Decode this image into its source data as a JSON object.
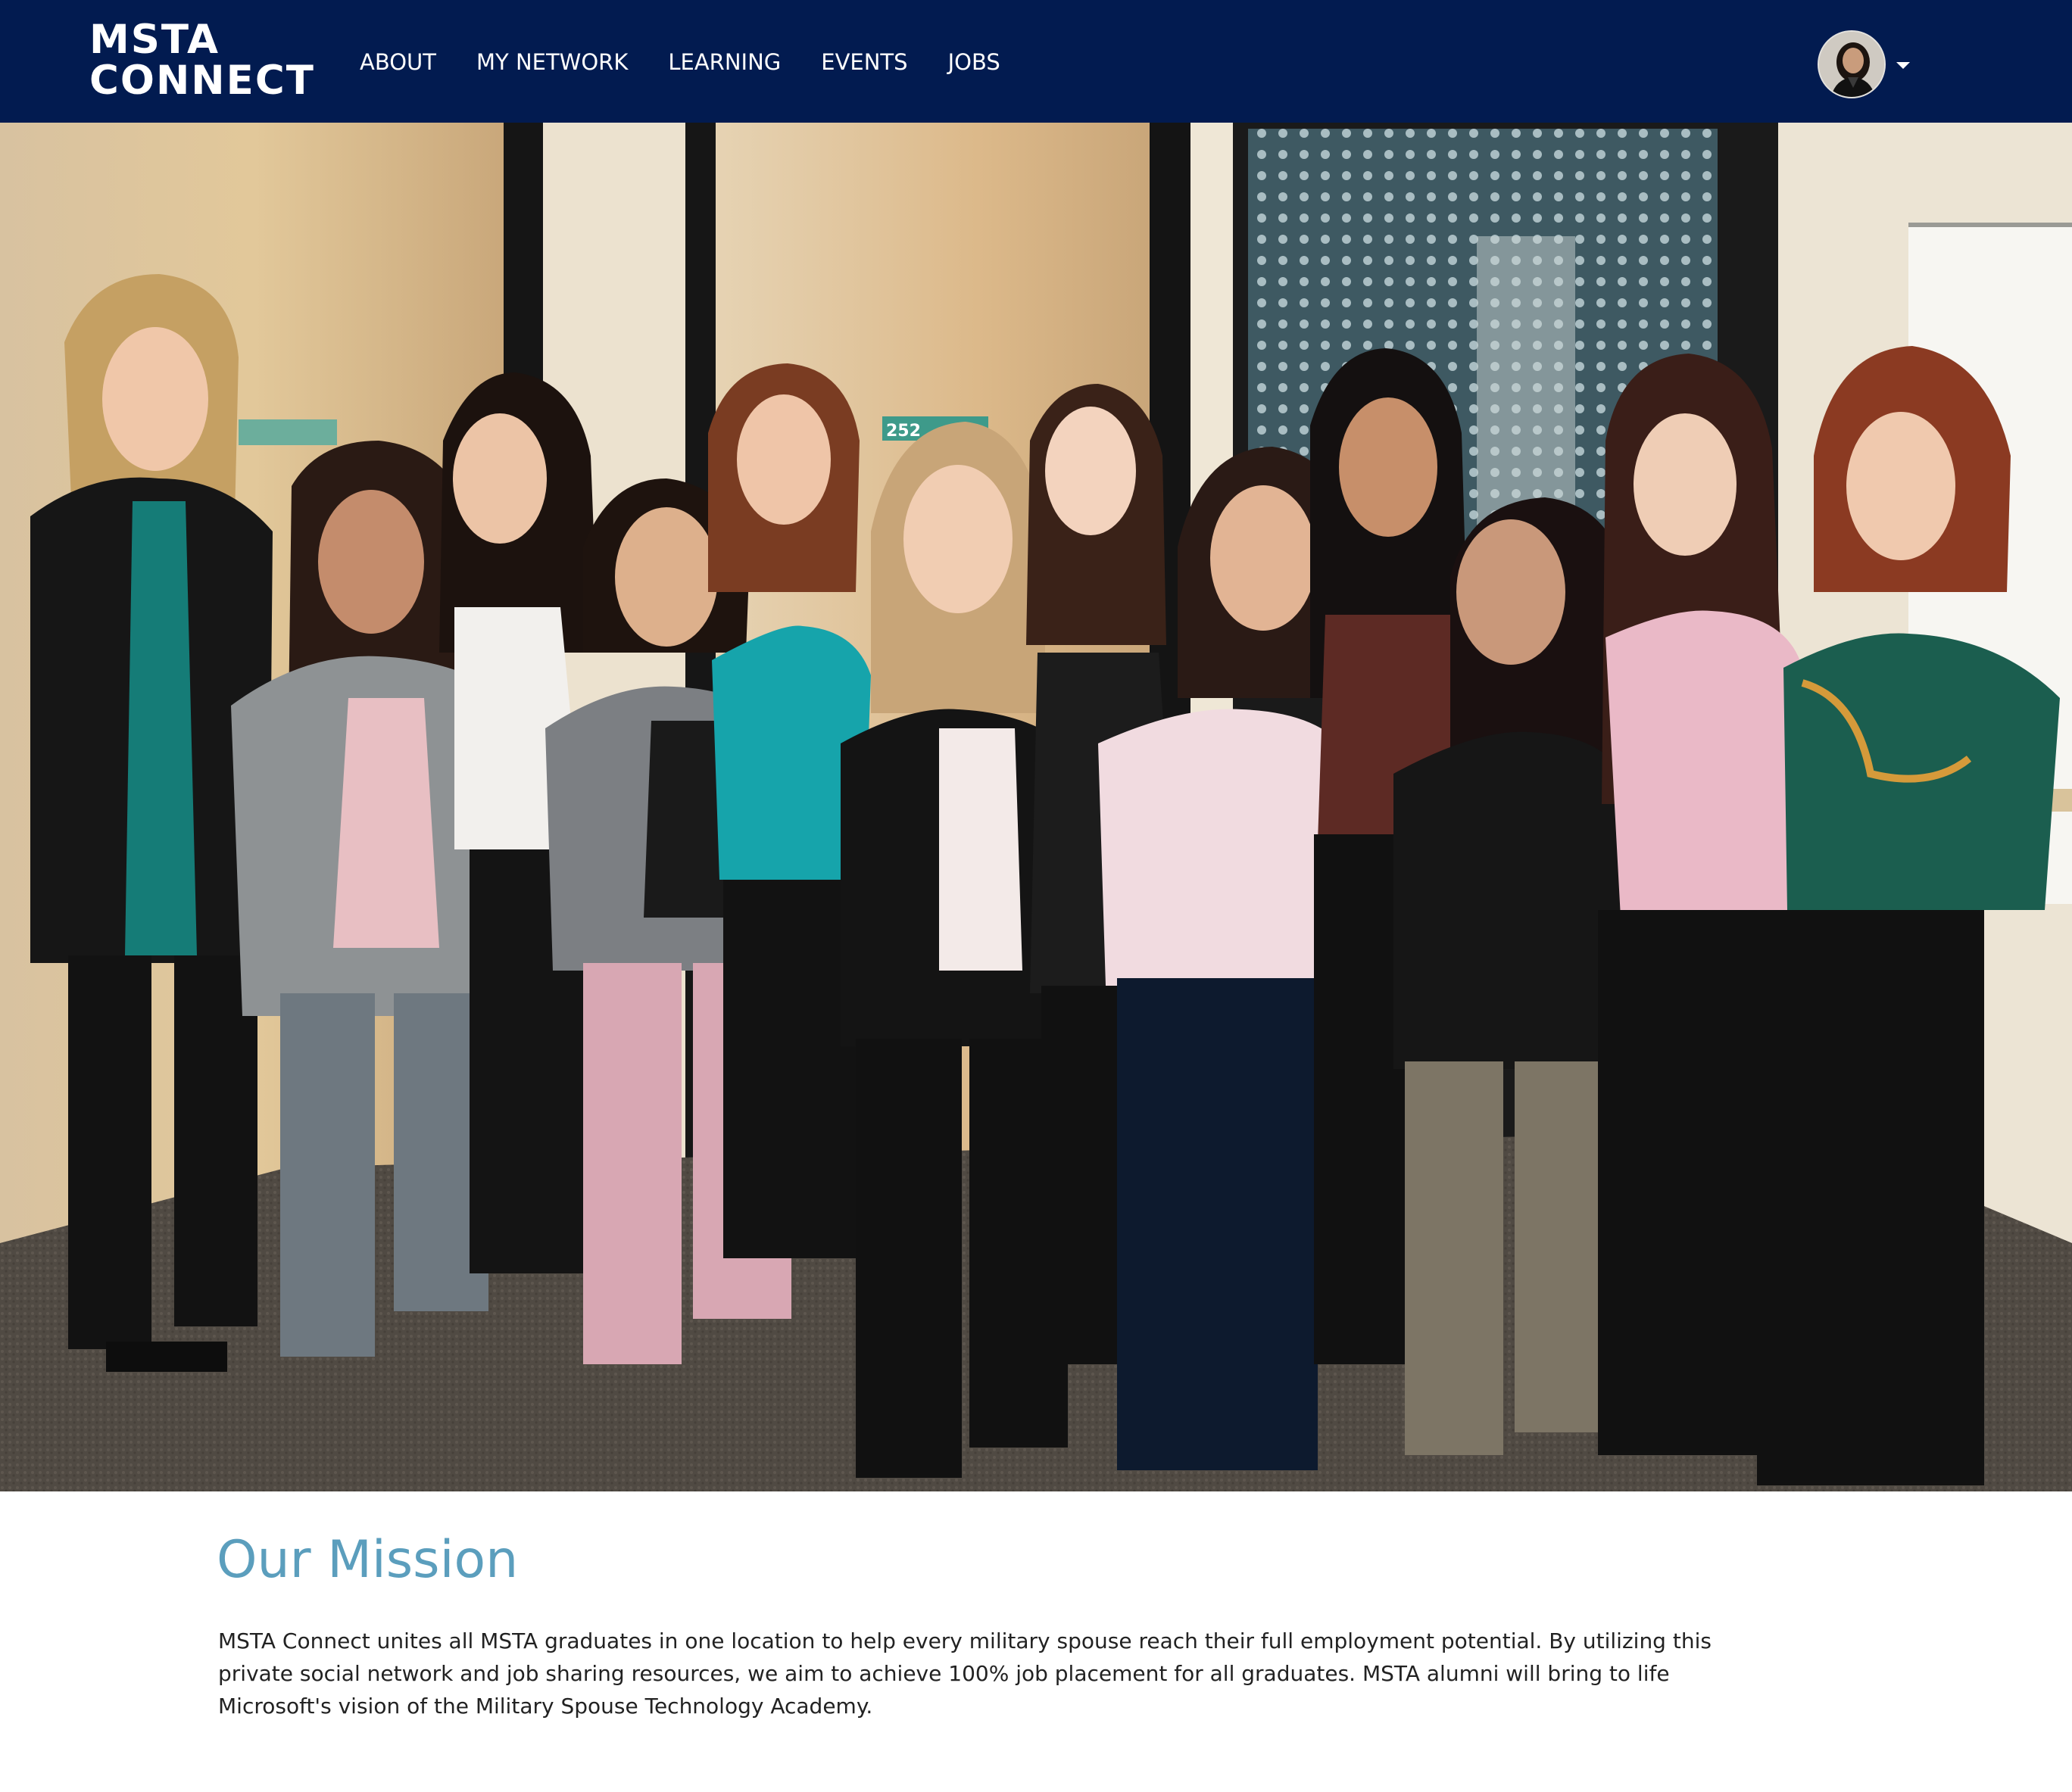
{
  "brand": {
    "line1": "MSTA",
    "line2": "CONNECT"
  },
  "nav": {
    "items": [
      {
        "label": "ABOUT"
      },
      {
        "label": "MY NETWORK"
      },
      {
        "label": "LEARNING"
      },
      {
        "label": "EVENTS"
      },
      {
        "label": "JOBS"
      }
    ]
  },
  "user_menu": {
    "avatar_icon": "user-avatar",
    "dropdown_icon": "caret-down-icon"
  },
  "hero": {
    "room_number": "252"
  },
  "mission": {
    "title": "Our Mission",
    "body": "MSTA Connect unites all MSTA graduates in one location to help every military spouse reach their full employment potential. By utilizing this private social network and job sharing resources, we aim to achieve 100% job placement for all graduates. MSTA alumni will bring to life Microsoft's vision of the Military Spouse Technology Academy."
  },
  "colors": {
    "navbar_bg": "#021b50",
    "nav_text": "#ffffff",
    "mission_title": "#5b9ebd",
    "body_text": "#222222"
  }
}
